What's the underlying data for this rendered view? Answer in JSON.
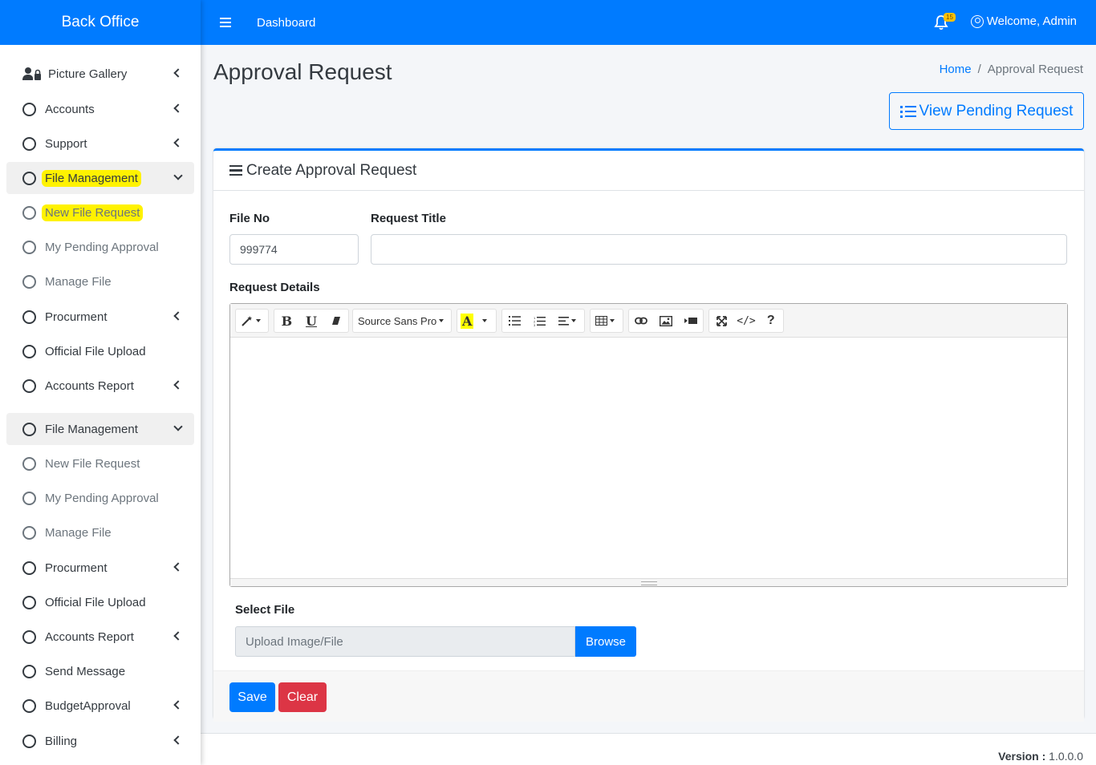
{
  "brand": "Back Office",
  "header": {
    "menu_link": "Dashboard",
    "notification_count": "15",
    "welcome": "Welcome, Admin"
  },
  "sidebar": {
    "items": [
      {
        "label": "Picture Gallery"
      },
      {
        "label": "Accounts"
      },
      {
        "label": "Support"
      },
      {
        "label": "File Management"
      },
      {
        "label": "New File Request"
      },
      {
        "label": "My Pending Approval"
      },
      {
        "label": "Manage File"
      },
      {
        "label": "Procurment"
      },
      {
        "label": "Official File Upload"
      },
      {
        "label": "Accounts Report"
      },
      {
        "label": "File Management"
      },
      {
        "label": "New File Request"
      },
      {
        "label": "My Pending Approval"
      },
      {
        "label": "Manage File"
      },
      {
        "label": "Procurment"
      },
      {
        "label": "Official File Upload"
      },
      {
        "label": "Accounts Report"
      },
      {
        "label": "Send Message"
      },
      {
        "label": "BudgetApproval"
      },
      {
        "label": "Billing"
      }
    ]
  },
  "page": {
    "title": "Approval Request",
    "breadcrumb": {
      "home": "Home",
      "current": "Approval Request"
    },
    "view_button": "View Pending Request"
  },
  "form": {
    "card_title": "Create Approval Request",
    "file_no_label": "File No",
    "file_no_value": "999774",
    "request_title_label": "Request Title",
    "request_title_value": "",
    "request_details_label": "Request Details",
    "editor_font": "Source Sans Pro",
    "select_file_label": "Select File",
    "file_placeholder": "Upload Image/File",
    "browse_label": "Browse",
    "save_label": "Save",
    "clear_label": "Clear"
  },
  "footer": {
    "version_label": "Version :",
    "version_value": "1.0.0.0"
  },
  "colors": {
    "primary": "#007bff",
    "danger": "#dc3545",
    "highlight": "#fff200"
  }
}
